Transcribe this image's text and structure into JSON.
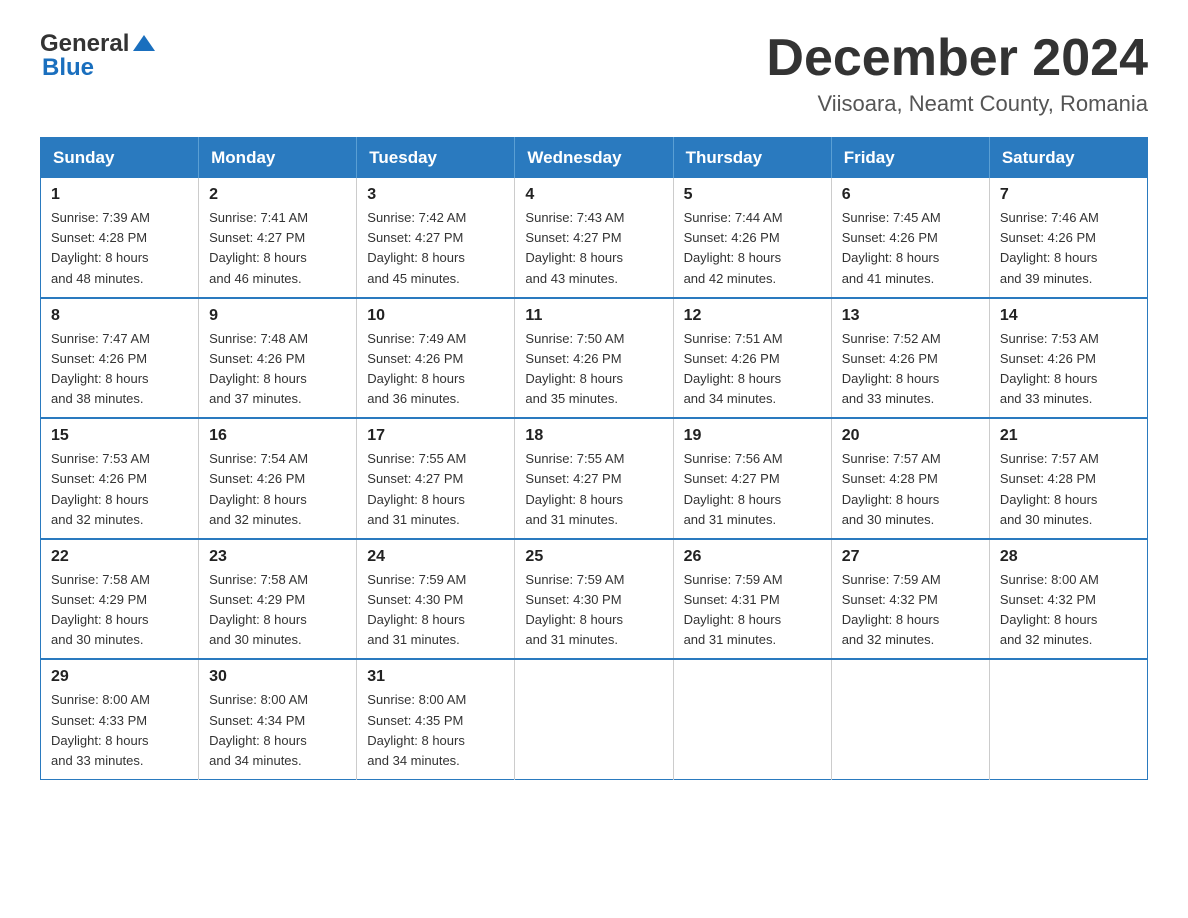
{
  "logo": {
    "general": "General",
    "blue": "Blue",
    "arrow": "▲"
  },
  "title": {
    "month": "December 2024",
    "location": "Viisoara, Neamt County, Romania"
  },
  "weekdays": [
    "Sunday",
    "Monday",
    "Tuesday",
    "Wednesday",
    "Thursday",
    "Friday",
    "Saturday"
  ],
  "weeks": [
    [
      {
        "day": "1",
        "sunrise": "7:39 AM",
        "sunset": "4:28 PM",
        "daylight": "8 hours and 48 minutes."
      },
      {
        "day": "2",
        "sunrise": "7:41 AM",
        "sunset": "4:27 PM",
        "daylight": "8 hours and 46 minutes."
      },
      {
        "day": "3",
        "sunrise": "7:42 AM",
        "sunset": "4:27 PM",
        "daylight": "8 hours and 45 minutes."
      },
      {
        "day": "4",
        "sunrise": "7:43 AM",
        "sunset": "4:27 PM",
        "daylight": "8 hours and 43 minutes."
      },
      {
        "day": "5",
        "sunrise": "7:44 AM",
        "sunset": "4:26 PM",
        "daylight": "8 hours and 42 minutes."
      },
      {
        "day": "6",
        "sunrise": "7:45 AM",
        "sunset": "4:26 PM",
        "daylight": "8 hours and 41 minutes."
      },
      {
        "day": "7",
        "sunrise": "7:46 AM",
        "sunset": "4:26 PM",
        "daylight": "8 hours and 39 minutes."
      }
    ],
    [
      {
        "day": "8",
        "sunrise": "7:47 AM",
        "sunset": "4:26 PM",
        "daylight": "8 hours and 38 minutes."
      },
      {
        "day": "9",
        "sunrise": "7:48 AM",
        "sunset": "4:26 PM",
        "daylight": "8 hours and 37 minutes."
      },
      {
        "day": "10",
        "sunrise": "7:49 AM",
        "sunset": "4:26 PM",
        "daylight": "8 hours and 36 minutes."
      },
      {
        "day": "11",
        "sunrise": "7:50 AM",
        "sunset": "4:26 PM",
        "daylight": "8 hours and 35 minutes."
      },
      {
        "day": "12",
        "sunrise": "7:51 AM",
        "sunset": "4:26 PM",
        "daylight": "8 hours and 34 minutes."
      },
      {
        "day": "13",
        "sunrise": "7:52 AM",
        "sunset": "4:26 PM",
        "daylight": "8 hours and 33 minutes."
      },
      {
        "day": "14",
        "sunrise": "7:53 AM",
        "sunset": "4:26 PM",
        "daylight": "8 hours and 33 minutes."
      }
    ],
    [
      {
        "day": "15",
        "sunrise": "7:53 AM",
        "sunset": "4:26 PM",
        "daylight": "8 hours and 32 minutes."
      },
      {
        "day": "16",
        "sunrise": "7:54 AM",
        "sunset": "4:26 PM",
        "daylight": "8 hours and 32 minutes."
      },
      {
        "day": "17",
        "sunrise": "7:55 AM",
        "sunset": "4:27 PM",
        "daylight": "8 hours and 31 minutes."
      },
      {
        "day": "18",
        "sunrise": "7:55 AM",
        "sunset": "4:27 PM",
        "daylight": "8 hours and 31 minutes."
      },
      {
        "day": "19",
        "sunrise": "7:56 AM",
        "sunset": "4:27 PM",
        "daylight": "8 hours and 31 minutes."
      },
      {
        "day": "20",
        "sunrise": "7:57 AM",
        "sunset": "4:28 PM",
        "daylight": "8 hours and 30 minutes."
      },
      {
        "day": "21",
        "sunrise": "7:57 AM",
        "sunset": "4:28 PM",
        "daylight": "8 hours and 30 minutes."
      }
    ],
    [
      {
        "day": "22",
        "sunrise": "7:58 AM",
        "sunset": "4:29 PM",
        "daylight": "8 hours and 30 minutes."
      },
      {
        "day": "23",
        "sunrise": "7:58 AM",
        "sunset": "4:29 PM",
        "daylight": "8 hours and 30 minutes."
      },
      {
        "day": "24",
        "sunrise": "7:59 AM",
        "sunset": "4:30 PM",
        "daylight": "8 hours and 31 minutes."
      },
      {
        "day": "25",
        "sunrise": "7:59 AM",
        "sunset": "4:30 PM",
        "daylight": "8 hours and 31 minutes."
      },
      {
        "day": "26",
        "sunrise": "7:59 AM",
        "sunset": "4:31 PM",
        "daylight": "8 hours and 31 minutes."
      },
      {
        "day": "27",
        "sunrise": "7:59 AM",
        "sunset": "4:32 PM",
        "daylight": "8 hours and 32 minutes."
      },
      {
        "day": "28",
        "sunrise": "8:00 AM",
        "sunset": "4:32 PM",
        "daylight": "8 hours and 32 minutes."
      }
    ],
    [
      {
        "day": "29",
        "sunrise": "8:00 AM",
        "sunset": "4:33 PM",
        "daylight": "8 hours and 33 minutes."
      },
      {
        "day": "30",
        "sunrise": "8:00 AM",
        "sunset": "4:34 PM",
        "daylight": "8 hours and 34 minutes."
      },
      {
        "day": "31",
        "sunrise": "8:00 AM",
        "sunset": "4:35 PM",
        "daylight": "8 hours and 34 minutes."
      },
      null,
      null,
      null,
      null
    ]
  ],
  "labels": {
    "sunrise": "Sunrise:",
    "sunset": "Sunset:",
    "daylight": "Daylight:"
  }
}
